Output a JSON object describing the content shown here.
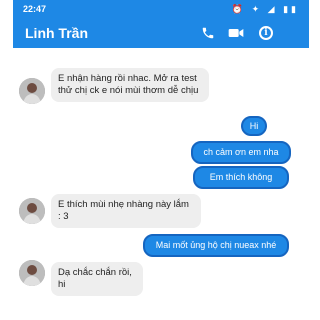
{
  "status_bar": {
    "time": "22:47",
    "icons": "⏰ ✦ ◢ ▮▮"
  },
  "header": {
    "contact_name": "Linh Trần",
    "icons": [
      "phone-icon",
      "video-icon",
      "info-icon"
    ],
    "info_glyph": "i"
  },
  "messages": [
    {
      "side": "in",
      "text": "E nhận hàng rồi nhac. Mở ra test thử chị ck e nói mùi thơm dễ chịu"
    },
    {
      "side": "out",
      "text": "Hi"
    },
    {
      "side": "out",
      "text": "ch cảm ơn em nha"
    },
    {
      "side": "out",
      "text": "Em thích không"
    },
    {
      "side": "in",
      "text": "E thích mùi nhẹ nhàng này lắm : 3"
    },
    {
      "side": "out",
      "text": "Mai mốt ủng hộ chị nueax nhé"
    },
    {
      "side": "in",
      "text": "Dạ chắc chắn rồi, hi"
    }
  ],
  "colors": {
    "accent": "#1e88e5",
    "incoming_bubble": "#eeeeee",
    "outgoing_border": "#1565c0"
  }
}
